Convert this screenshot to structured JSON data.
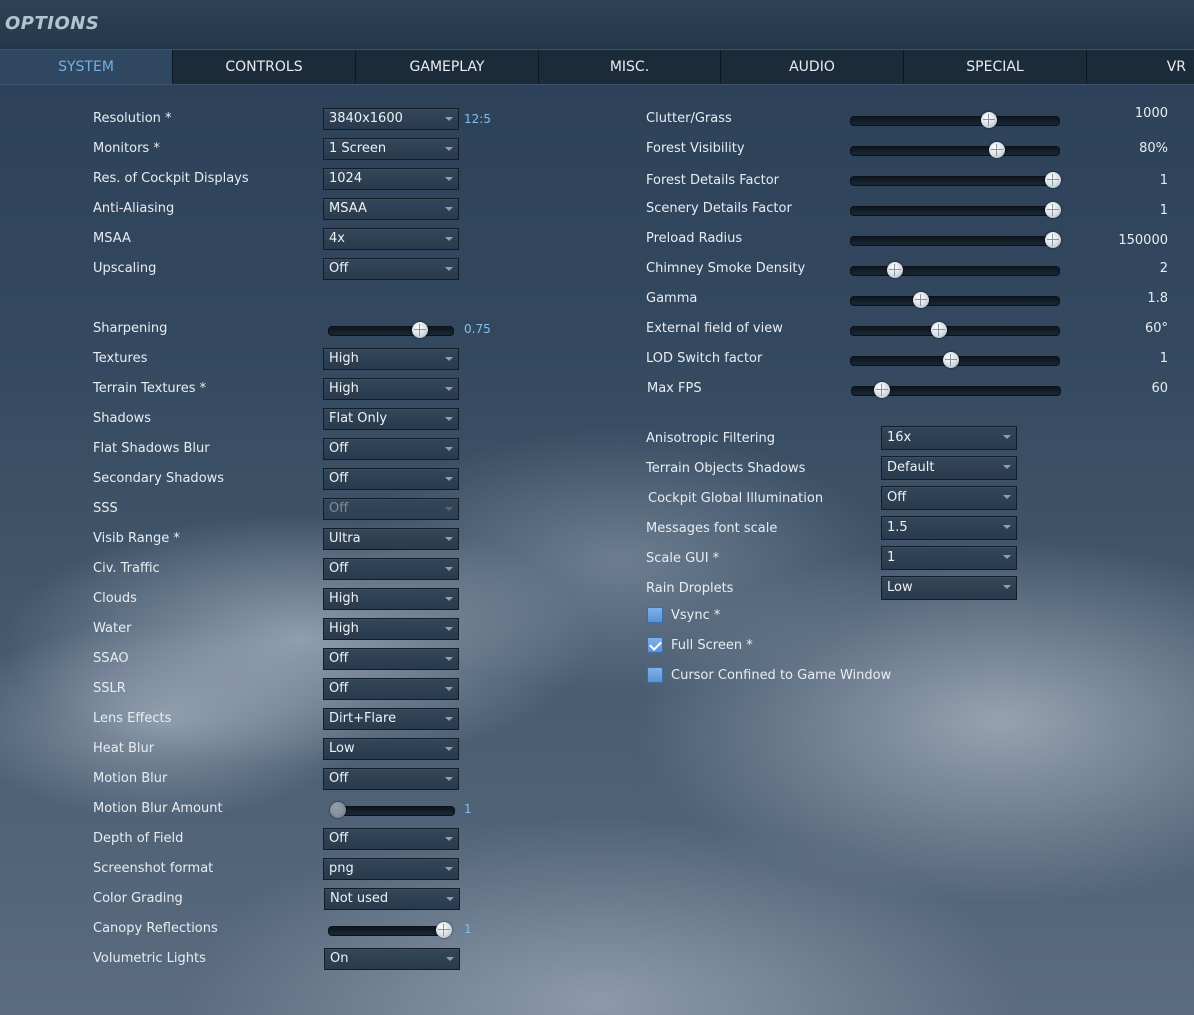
{
  "window": {
    "title": "OPTIONS"
  },
  "tabs": [
    "SYSTEM",
    "CONTROLS",
    "GAMEPLAY",
    "MISC.",
    "AUDIO",
    "SPECIAL",
    "VR"
  ],
  "active_tab": "SYSTEM",
  "left": {
    "resolution": {
      "label": "Resolution *",
      "value": "3840x1600",
      "aspect": "12:5"
    },
    "monitors": {
      "label": "Monitors *",
      "value": "1 Screen"
    },
    "cockpit_displays": {
      "label": "Res. of Cockpit Displays",
      "value": "1024"
    },
    "anti_aliasing": {
      "label": "Anti-Aliasing",
      "value": "MSAA"
    },
    "msaa": {
      "label": "MSAA",
      "value": "4x"
    },
    "upscaling": {
      "label": "Upscaling",
      "value": "Off"
    },
    "sharpening": {
      "label": "Sharpening",
      "value": "0.75",
      "level": 0.75
    },
    "textures": {
      "label": "Textures",
      "value": "High"
    },
    "terrain_textures": {
      "label": "Terrain Textures *",
      "value": "High"
    },
    "shadows": {
      "label": "Shadows",
      "value": "Flat Only"
    },
    "flat_shadows_blur": {
      "label": "Flat Shadows Blur",
      "value": "Off"
    },
    "secondary_shadows": {
      "label": "Secondary Shadows",
      "value": "Off"
    },
    "sss": {
      "label": "SSS",
      "value": "Off",
      "disabled": true
    },
    "visib_range": {
      "label": "Visib Range *",
      "value": "Ultra"
    },
    "civ_traffic": {
      "label": "Civ. Traffic",
      "value": "Off"
    },
    "clouds": {
      "label": "Clouds",
      "value": "High"
    },
    "water": {
      "label": "Water",
      "value": "High"
    },
    "ssao": {
      "label": "SSAO",
      "value": "Off"
    },
    "sslr": {
      "label": "SSLR",
      "value": "Off"
    },
    "lens_effects": {
      "label": "Lens Effects",
      "value": "Dirt+Flare"
    },
    "heat_blur": {
      "label": "Heat Blur",
      "value": "Low"
    },
    "motion_blur": {
      "label": "Motion Blur",
      "value": "Off"
    },
    "motion_blur_amount": {
      "label": "Motion Blur Amount",
      "value": "1",
      "level": 0.0,
      "disabled": true
    },
    "depth_of_field": {
      "label": "Depth of Field",
      "value": "Off"
    },
    "screenshot_format": {
      "label": "Screenshot format",
      "value": "png"
    },
    "color_grading": {
      "label": "Color Grading",
      "value": "Not used"
    },
    "canopy_reflections": {
      "label": "Canopy Reflections",
      "value": "1",
      "level": 1.0
    },
    "volumetric_lights": {
      "label": "Volumetric Lights",
      "value": "On"
    }
  },
  "right": {
    "clutter_grass": {
      "label": "Clutter/Grass",
      "value": "1000",
      "level": 0.67
    },
    "forest_visibility": {
      "label": "Forest Visibility",
      "value": "80%",
      "level": 0.71
    },
    "forest_details": {
      "label": "Forest Details Factor",
      "value": "1",
      "level": 0.99
    },
    "scenery_details": {
      "label": "Scenery Details Factor",
      "value": "1",
      "level": 0.99
    },
    "preload_radius": {
      "label": "Preload Radius",
      "value": "150000",
      "level": 0.99
    },
    "chimney_smoke": {
      "label": "Chimney Smoke Density",
      "value": "2",
      "level": 0.2
    },
    "gamma": {
      "label": "Gamma",
      "value": "1.8",
      "level": 0.33
    },
    "external_fov": {
      "label": "External field of view",
      "value": "60°",
      "level": 0.42
    },
    "lod_switch": {
      "label": "LOD Switch factor",
      "value": "1",
      "level": 0.48
    },
    "max_fps": {
      "label": "Max FPS",
      "value": "60",
      "level": 0.13
    },
    "anisotropic": {
      "label": "Anisotropic Filtering",
      "value": "16x"
    },
    "terrain_obj_shadows": {
      "label": "Terrain Objects Shadows",
      "value": "Default"
    },
    "cockpit_gi": {
      "label": "Cockpit Global Illumination",
      "value": "Off"
    },
    "messages_font": {
      "label": "Messages font scale",
      "value": "1.5"
    },
    "scale_gui": {
      "label": "Scale GUI *",
      "value": "1"
    },
    "rain_droplets": {
      "label": "Rain Droplets",
      "value": "Low"
    },
    "vsync": {
      "label": "Vsync *",
      "checked": false
    },
    "full_screen": {
      "label": "Full Screen *",
      "checked": true
    },
    "cursor_confined": {
      "label": "Cursor Confined to Game Window",
      "checked": false
    }
  },
  "colors": {
    "accent": "#6fb3e8",
    "checkbox": "#6aa3e0",
    "value_blue": "#7fc0ef"
  }
}
